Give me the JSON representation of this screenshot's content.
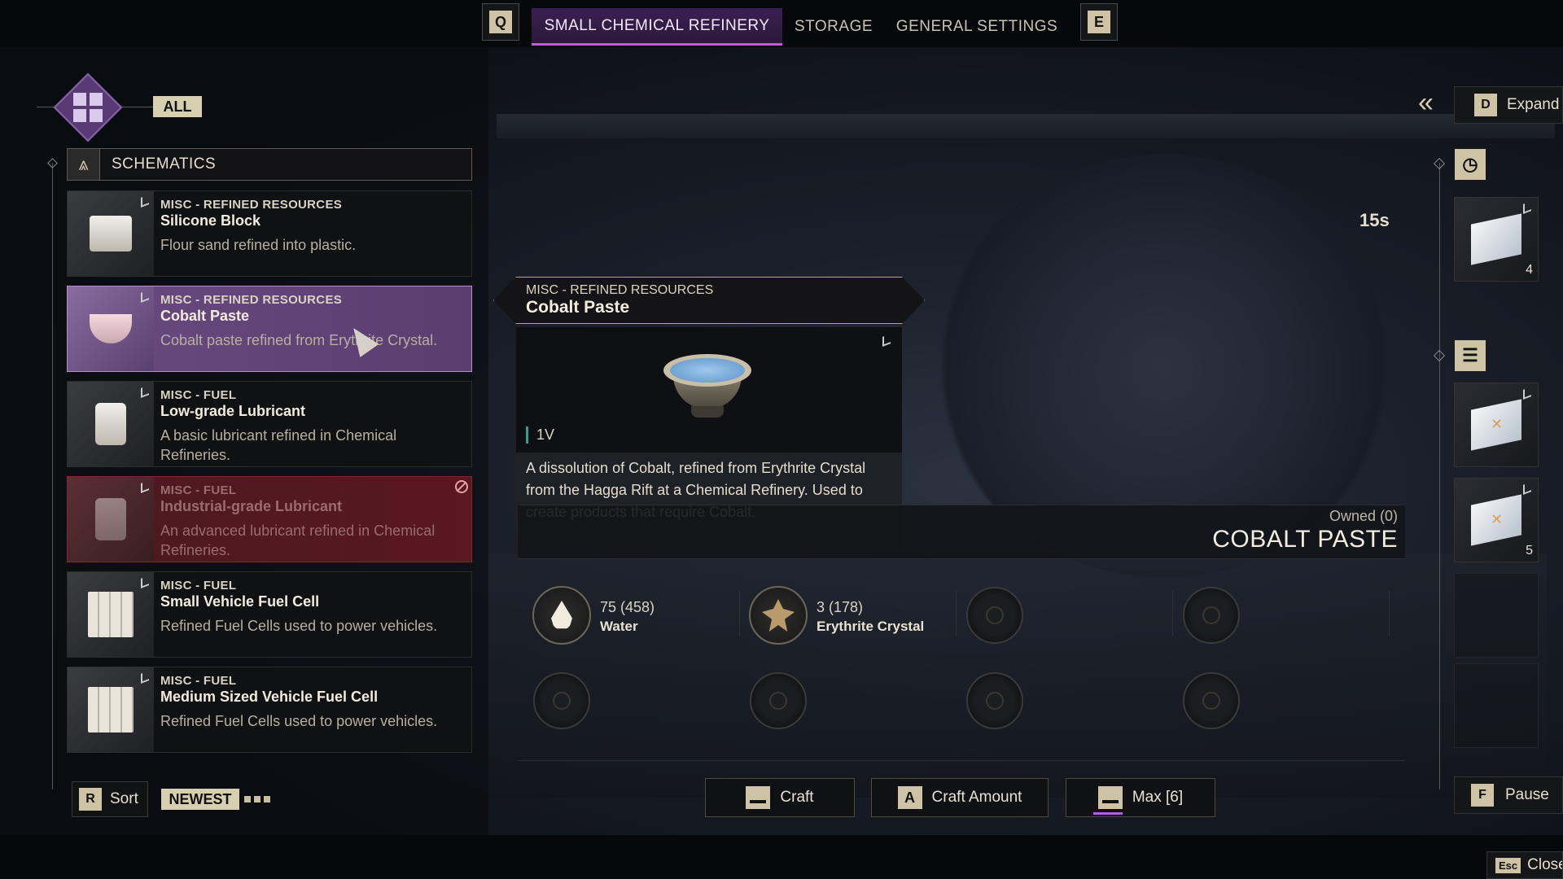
{
  "top_tabs": {
    "left_key": "Q",
    "right_key": "E",
    "tabs": [
      {
        "label": "SMALL CHEMICAL REFINERY",
        "active": true
      },
      {
        "label": "STORAGE",
        "active": false
      },
      {
        "label": "GENERAL SETTINGS",
        "active": false
      }
    ]
  },
  "filter": {
    "label": "ALL"
  },
  "schematics": {
    "header": "SCHEMATICS",
    "cards": [
      {
        "category": "MISC - REFINED RESOURCES",
        "name": "Silicone Block",
        "description": "Flour sand refined into plastic.",
        "state": "normal",
        "thumb_icon": "block-icon"
      },
      {
        "category": "MISC - REFINED RESOURCES",
        "name": "Cobalt Paste",
        "description": "Cobalt paste refined from Erythrite Crystal.",
        "state": "selected",
        "thumb_icon": "bowl-icon"
      },
      {
        "category": "MISC - FUEL",
        "name": "Low-grade Lubricant",
        "description": "A basic lubricant refined in Chemical Refineries.",
        "state": "normal",
        "thumb_icon": "jar-icon"
      },
      {
        "category": "MISC - FUEL",
        "name": "Industrial-grade Lubricant",
        "description": "An advanced lubricant refined in Chemical Refineries.",
        "state": "locked",
        "thumb_icon": "barrels-icon"
      },
      {
        "category": "MISC - FUEL",
        "name": "Small Vehicle Fuel Cell",
        "description": "Refined Fuel Cells used to power vehicles.",
        "state": "normal",
        "thumb_icon": "fuel-cell-icon"
      },
      {
        "category": "MISC - FUEL",
        "name": "Medium Sized Vehicle Fuel Cell",
        "description": "Refined Fuel Cells used to power vehicles.",
        "state": "normal",
        "thumb_icon": "fuel-cell-icon"
      }
    ]
  },
  "sort": {
    "key": "R",
    "label": "Sort",
    "value": "NEWEST"
  },
  "tooltip": {
    "category": "MISC - REFINED RESOURCES",
    "name": "Cobalt Paste",
    "volume": "1V",
    "description": "A dissolution of Cobalt, refined from Erythrite Crystal from the Hagga Rift at a Chemical Refinery. Used to create products that require Cobalt."
  },
  "product": {
    "owned": "Owned (0)",
    "name": "COBALT PASTE"
  },
  "ingredients": [
    {
      "amount": "75 (458)",
      "name": "Water",
      "icon": "water-drop-icon"
    },
    {
      "amount": "3 (178)",
      "name": "Erythrite Crystal",
      "icon": "crystal-icon"
    }
  ],
  "actions": {
    "craft": {
      "label": "Craft"
    },
    "craft_amount": {
      "key": "A",
      "label": "Craft Amount"
    },
    "max": {
      "label": "Max [6]"
    }
  },
  "right_panel": {
    "expand": {
      "key": "D",
      "label": "Expand"
    },
    "timer": "15s",
    "queue_qty": "4",
    "output_qty": "5",
    "pause": {
      "key": "F",
      "label": "Pause"
    }
  },
  "close": {
    "key": "Esc",
    "label": "Close"
  },
  "colors": {
    "accent": "#b45be0",
    "selected_card": "#6a4a80",
    "locked_card": "#5a1820",
    "keycap": "#cfc3a6"
  }
}
